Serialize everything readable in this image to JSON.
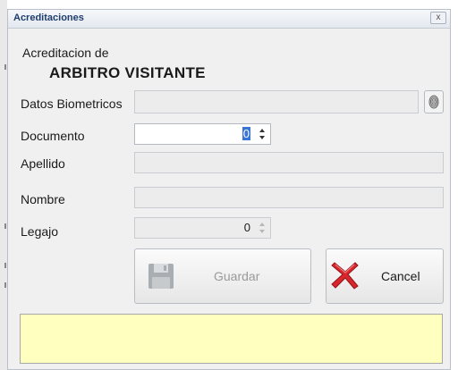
{
  "window": {
    "title": "Acreditaciones",
    "close_label": "x"
  },
  "heading": {
    "subtitle": "Acreditacion de",
    "role": "ARBITRO VISITANTE"
  },
  "form": {
    "biometric_label": "Datos Biometricos",
    "documento_label": "Documento",
    "documento_value": "0",
    "apellido_label": "Apellido",
    "nombre_label": "Nombre",
    "legajo_label": "Legajo",
    "legajo_value": "0"
  },
  "buttons": {
    "save_label": "Guardar",
    "cancel_label": "Cancel"
  },
  "status": {
    "message": ""
  },
  "colors": {
    "status_bg": "#ffffc0",
    "selection": "#3875d7",
    "title_text": "#1e3d6b"
  },
  "icons": {
    "fingerprint": "fingerprint-icon",
    "save": "floppy-disk-icon",
    "cancel": "red-x-icon"
  }
}
